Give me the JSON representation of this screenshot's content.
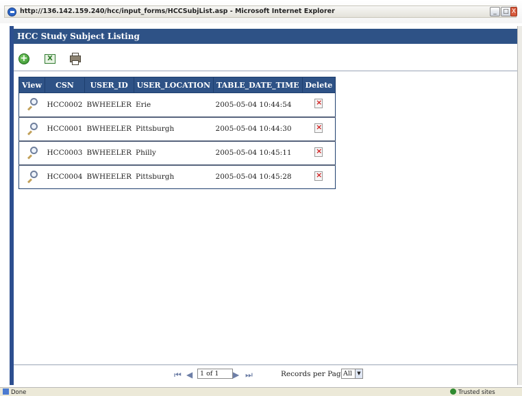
{
  "window": {
    "title": "http://136.142.159.240/hcc/input_forms/HCCSubjList.asp - Microsoft Internet Explorer",
    "min_label": "_",
    "max_label": "□",
    "close_label": "X"
  },
  "page": {
    "header": "HCC Study Subject Listing"
  },
  "toolbar": {
    "add_icon": "add-circle-icon",
    "add_glyph": "+",
    "excel_icon": "excel-export-icon",
    "excel_glyph": "X",
    "print_icon": "printer-icon"
  },
  "table": {
    "columns": [
      "View",
      "CSN",
      "USER_ID",
      "USER_LOCATION",
      "TABLE_DATE_TIME",
      "Delete"
    ],
    "rows": [
      {
        "csn": "HCC0002",
        "user_id": "BWHEELER",
        "location": "Erie",
        "datetime": "2005-05-04 10:44:54"
      },
      {
        "csn": "HCC0001",
        "user_id": "BWHEELER",
        "location": "Pittsburgh",
        "datetime": "2005-05-04 10:44:30"
      },
      {
        "csn": "HCC0003",
        "user_id": "BWHEELER",
        "location": "Philly",
        "datetime": "2005-05-04 10:45:11"
      },
      {
        "csn": "HCC0004",
        "user_id": "BWHEELER",
        "location": "Pittsburgh",
        "datetime": "2005-05-04 10:45:28"
      }
    ]
  },
  "pager": {
    "first_glyph": "⏮",
    "prev_glyph": "◀",
    "page_value": "1 of 1",
    "next_glyph": "▶",
    "last_glyph": "⏭",
    "records_label": "Records per Page:",
    "records_value": "All",
    "select_arrow": "▼"
  },
  "statusbar": {
    "left": "Done",
    "right": "Trusted sites"
  },
  "colors": {
    "header_bg": "#2e5286",
    "frame": "#2d4f8f"
  }
}
